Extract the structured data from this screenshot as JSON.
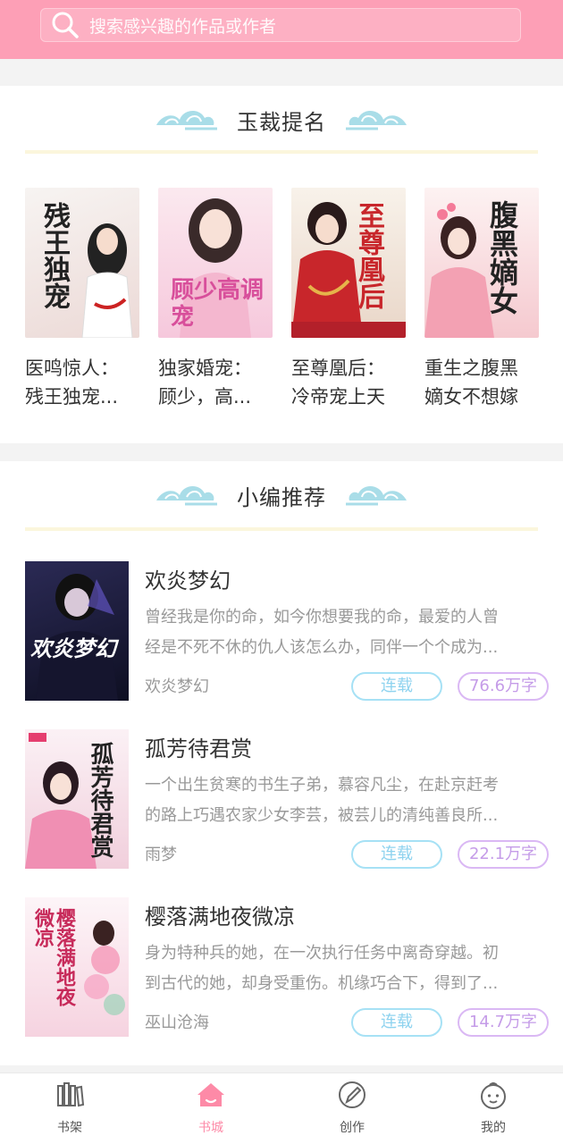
{
  "search": {
    "placeholder": "搜索感兴趣的作品或作者"
  },
  "sections": {
    "featured": {
      "title": "玉裁提名",
      "books": [
        {
          "line1": "医鸣惊人：",
          "line2": "残王独宠...",
          "cover_text": "残王独宠",
          "cover_color": "#f4f1ef",
          "text_color": "#2a2a2a"
        },
        {
          "line1": "独家婚宠：",
          "line2": "顾少，高...",
          "cover_text": "顾少高调宠",
          "cover_color": "#f8d9e6",
          "text_color": "#d84f9b"
        },
        {
          "line1": "至尊凰后：",
          "line2": "冷帝宠上天",
          "cover_text": "至尊凰后",
          "cover_color": "#f6ede6",
          "text_color": "#c8262b"
        },
        {
          "line1": "重生之腹黑",
          "line2": "嫡女不想嫁",
          "cover_text": "腹黑嫡女",
          "cover_color": "#fbe8ea",
          "text_color": "#2a2a2a"
        }
      ]
    },
    "recommend": {
      "title": "小编推荐",
      "books": [
        {
          "title": "欢炎梦幻",
          "desc1": "曾经我是你的命，如今你想要我的命，最爱的人曾",
          "desc2": "经是不死不休的仇人该怎么办，同伴一个个成为...",
          "author": "欢炎梦幻",
          "status": "连载",
          "words": "76.6万字",
          "cover_text": "欢炎梦幻",
          "cover_color": "#1e2040"
        },
        {
          "title": "孤芳待君赏",
          "desc1": "一个出生贫寒的书生子弟，慕容凡尘，在赴京赶考",
          "desc2": "的路上巧遇农家少女李芸，被芸儿的清纯善良所...",
          "author": "雨梦",
          "status": "连载",
          "words": "22.1万字",
          "cover_text": "孤芳待君赏",
          "cover_color": "#f6e4ec"
        },
        {
          "title": "樱落满地夜微凉",
          "desc1": "身为特种兵的她，在一次执行任务中离奇穿越。初",
          "desc2": "到古代的她，却身受重伤。机缘巧合下，得到了...",
          "author": "巫山沧海",
          "status": "连载",
          "words": "14.7万字",
          "cover_text": "樱落满地夜微凉",
          "cover_color": "#fbeaf0"
        }
      ]
    }
  },
  "nav": [
    {
      "label": "书架",
      "icon": "bookshelf-icon",
      "active": false
    },
    {
      "label": "书城",
      "icon": "house-icon",
      "active": true
    },
    {
      "label": "创作",
      "icon": "pen-icon",
      "active": false
    },
    {
      "label": "我的",
      "icon": "baby-face-icon",
      "active": false
    }
  ],
  "colors": {
    "accent": "#fd9fb6",
    "status_border": "#a6e1f5",
    "words_border": "#dab8f4"
  }
}
